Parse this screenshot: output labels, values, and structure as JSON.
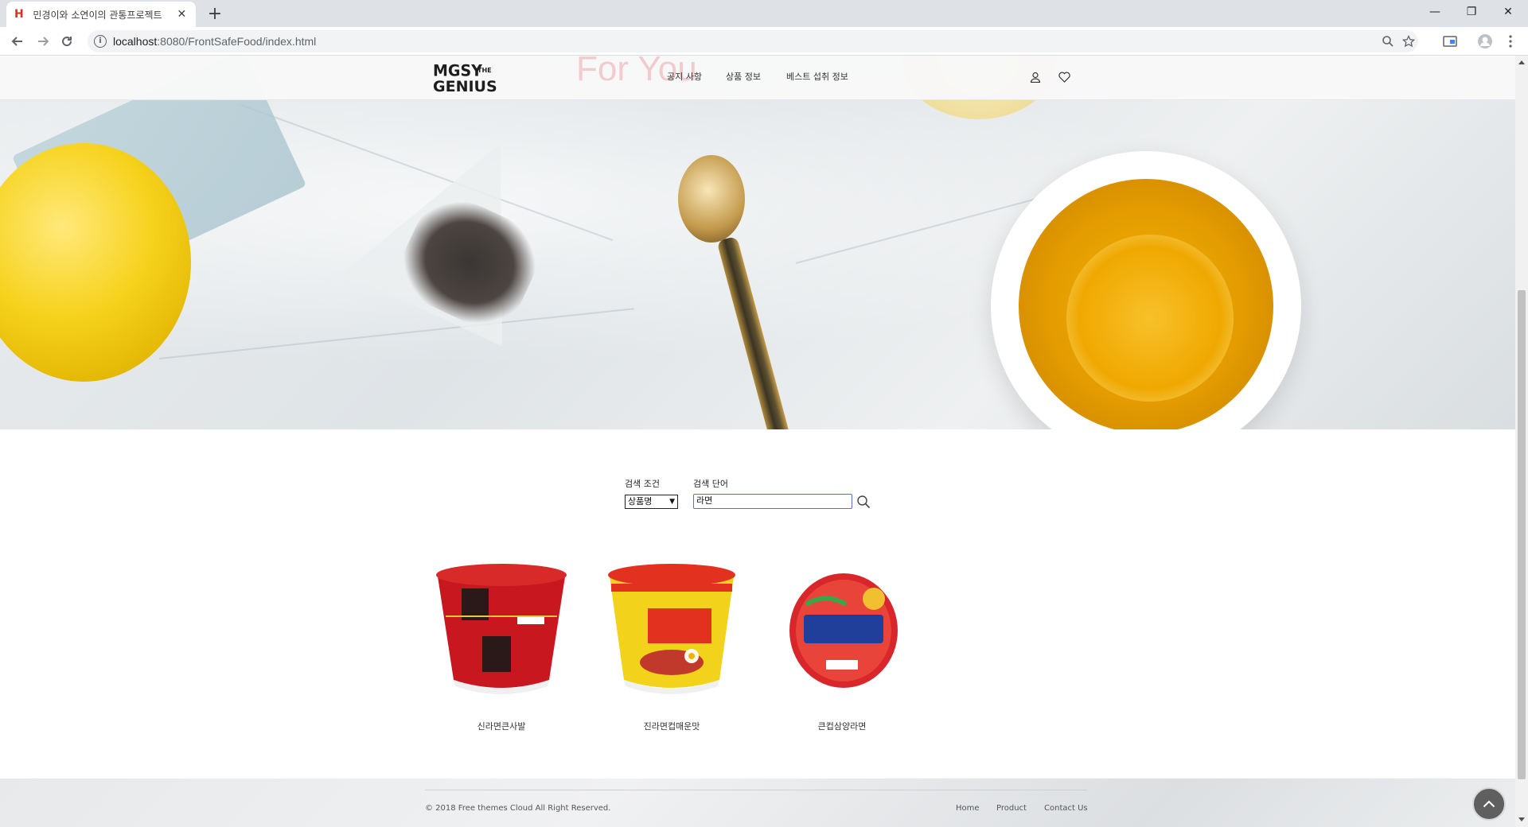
{
  "browser": {
    "tab_title": "민경이와 소연이의 관통프로젝트",
    "tab_favicon": "H",
    "url_host": "localhost",
    "url_rest": ":8080/FrontSafeFood/index.html"
  },
  "header": {
    "logo_line1": "MGSY",
    "logo_the": "THE",
    "logo_line2": "GENIUS",
    "hero_overlay_text": "For You",
    "nav": [
      "공지 사항",
      "상품 정보",
      "베스트 섭취 정보"
    ]
  },
  "search": {
    "condition_label": "검색 조건",
    "word_label": "검색 단어",
    "selected_condition": "상품명",
    "query": "라면"
  },
  "products": [
    {
      "name": "신라면큰사발"
    },
    {
      "name": "진라면컵매운맛"
    },
    {
      "name": "큰컵삼양라면"
    }
  ],
  "footer": {
    "copyright": "© 2018 Free themes Cloud All Right Reserved.",
    "links": [
      "Home",
      "Product",
      "Contact Us"
    ]
  },
  "colors": {
    "accent": "#5b6bd8",
    "text": "#333333"
  }
}
